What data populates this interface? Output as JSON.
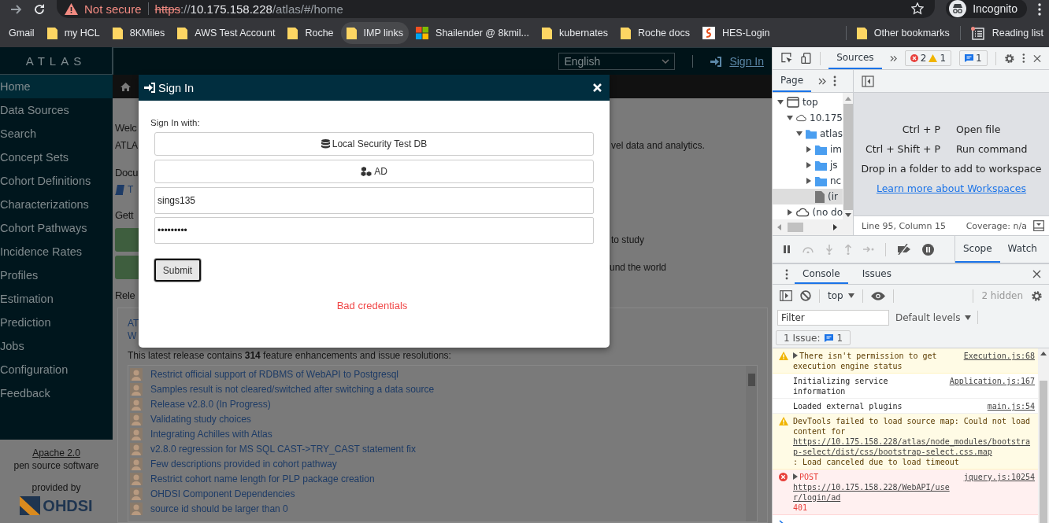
{
  "browser": {
    "security": "Not secure",
    "url": {
      "scheme": "https",
      "separator": "://",
      "host": "10.175.158.228",
      "path": "/atlas/#/home"
    },
    "profile": "Incognito",
    "bookmarks": [
      {
        "label": "Gmail",
        "kind": "plain",
        "selected": false
      },
      {
        "label": "my HCL",
        "kind": "folder",
        "selected": false
      },
      {
        "label": "8KMiles",
        "kind": "folder",
        "selected": false
      },
      {
        "label": "AWS Test Account",
        "kind": "folder",
        "selected": false
      },
      {
        "label": "Roche",
        "kind": "folder",
        "selected": false
      },
      {
        "label": "IMP links",
        "kind": "folder",
        "selected": true
      },
      {
        "label": "Shailender @ 8kmil...",
        "kind": "tiles",
        "selected": false
      },
      {
        "label": "kubernates",
        "kind": "folder",
        "selected": false
      },
      {
        "label": "Roche docs",
        "kind": "folder",
        "selected": false
      },
      {
        "label": "HES-Login",
        "kind": "site",
        "selected": false
      }
    ],
    "other_bookmarks": "Other bookmarks",
    "reading_list": "Reading list"
  },
  "atlas": {
    "logo": "ATLAS",
    "sidebar": [
      {
        "label": "Home",
        "selected": true
      },
      {
        "label": "Data Sources",
        "selected": false
      },
      {
        "label": "Search",
        "selected": false
      },
      {
        "label": "Concept Sets",
        "selected": false
      },
      {
        "label": "Cohort Definitions",
        "selected": false
      },
      {
        "label": "Characterizations",
        "selected": false
      },
      {
        "label": "Cohort Pathways",
        "selected": false
      },
      {
        "label": "Incidence Rates",
        "selected": false
      },
      {
        "label": "Profiles",
        "selected": false
      },
      {
        "label": "Estimation",
        "selected": false
      },
      {
        "label": "Prediction",
        "selected": false
      },
      {
        "label": "Jobs",
        "selected": false
      },
      {
        "label": "Configuration",
        "selected": false
      },
      {
        "label": "Feedback",
        "selected": false
      }
    ],
    "footer": {
      "license": "Apache 2.0",
      "license_note": "pen source software",
      "provided_by": "provided by",
      "org": "OHDSI"
    },
    "language": "English",
    "sign_in": "Sign In",
    "background": {
      "welcome": "Welc",
      "intro_left": "ATLA",
      "intro_right": "vel data and analytics.",
      "docs": "Docu",
      "docs_link": "T",
      "getting": "Gett",
      "step_1_right": "to study",
      "step_2_right": "und the world",
      "releases": "Rele",
      "release_title": "AT",
      "release_sub": "W",
      "release_summary": "This latest release contains **314** feature enhancements and issue resolutions:",
      "issues": [
        "Restrict official support of RDBMS of WebAPI to Postgresql",
        "Samples result is not cleared/switched after switching a data source",
        "Release v2.8.0 (In Progress)",
        "Validating study choices",
        "Integrating Achilles with Atlas",
        "v2.8.0 regression for MS SQL CAST->TRY_CAST statement fix",
        "Few descriptions provided in cohort pathway",
        "Restrict cohort name length for PLP package creation",
        "OHDSI Component Dependencies",
        "source id should be larger than 0"
      ]
    }
  },
  "dialog": {
    "title": "Sign In",
    "prompt": "Sign In with:",
    "providers": [
      {
        "label": "Local Security Test DB",
        "kind": "database"
      },
      {
        "label": "AD",
        "kind": "cubes"
      }
    ],
    "username": "sings135",
    "password": "•••••••••",
    "submit": "Submit",
    "error": "Bad credentials"
  },
  "devtools": {
    "tabs": [
      {
        "label": "Sources",
        "selected": true
      }
    ],
    "errors": "2",
    "warnings": "1",
    "messages": "1",
    "navigator_tabs": [
      {
        "label": "Page",
        "selected": true
      }
    ],
    "tree": [
      {
        "label": "top",
        "kind": "frame",
        "expanded": true,
        "selected": false,
        "children": [
          {
            "label": "10.175",
            "kind": "cloud",
            "expanded": true,
            "selected": false,
            "children": [
              {
                "label": "atlas",
                "kind": "folder",
                "expanded": true,
                "selected": false,
                "children": [
                  {
                    "label": "im",
                    "kind": "folder",
                    "expanded": false,
                    "selected": false
                  },
                  {
                    "label": "js",
                    "kind": "folder",
                    "expanded": false,
                    "selected": false
                  },
                  {
                    "label": "nc",
                    "kind": "folder",
                    "expanded": false,
                    "selected": false
                  },
                  {
                    "label": "(ir",
                    "kind": "file",
                    "selected": true
                  }
                ]
              }
            ]
          },
          {
            "label": "(no do",
            "kind": "cloud",
            "expanded": false,
            "selected": false
          }
        ]
      }
    ],
    "shortcuts": [
      {
        "keys": "Ctrl + P",
        "action": "Open file"
      },
      {
        "keys": "Ctrl + Shift + P",
        "action": "Run command"
      }
    ],
    "drop_hint": "Drop in a folder to add to workspace",
    "workspaces_link": "Learn more about Workspaces",
    "position": "Line 95, Column 15",
    "coverage": "Coverage: n/a",
    "side_tabs": [
      {
        "label": "Scope",
        "selected": true
      },
      {
        "label": "Watch",
        "selected": false
      }
    ],
    "drawer_tabs": [
      {
        "label": "Console",
        "selected": true
      },
      {
        "label": "Issues",
        "selected": false
      }
    ],
    "context": "top",
    "hidden": "2 hidden",
    "filter_placeholder": "Filter",
    "levels": "Default levels",
    "issues_label": "1 Issue:",
    "issues_count": "1",
    "console": [
      {
        "kind": "warning",
        "expandable": true,
        "text": "There isn't permission to get execution engine status",
        "source": "Execution.js:68"
      },
      {
        "kind": "info",
        "expandable": false,
        "text": "Initializing service information",
        "source": "Application.js:167"
      },
      {
        "kind": "info",
        "expandable": false,
        "text": "Loaded external plugins",
        "source": "main.js:54"
      },
      {
        "kind": "warning",
        "expandable": false,
        "text": "DevTools failed to load source map: Could not load content for",
        "link": "https://10.175.158.228/atlas/node_modules/bootstrap-select/dist/css/bootstrap-select.css.map",
        "after": ": Load canceled due to load timeout"
      },
      {
        "kind": "error",
        "expandable": true,
        "text": "POST",
        "link": "https://10.175.158.228/WebAPI/user/login/ad",
        "after": "401",
        "source": "jquery.js:10254"
      }
    ]
  }
}
